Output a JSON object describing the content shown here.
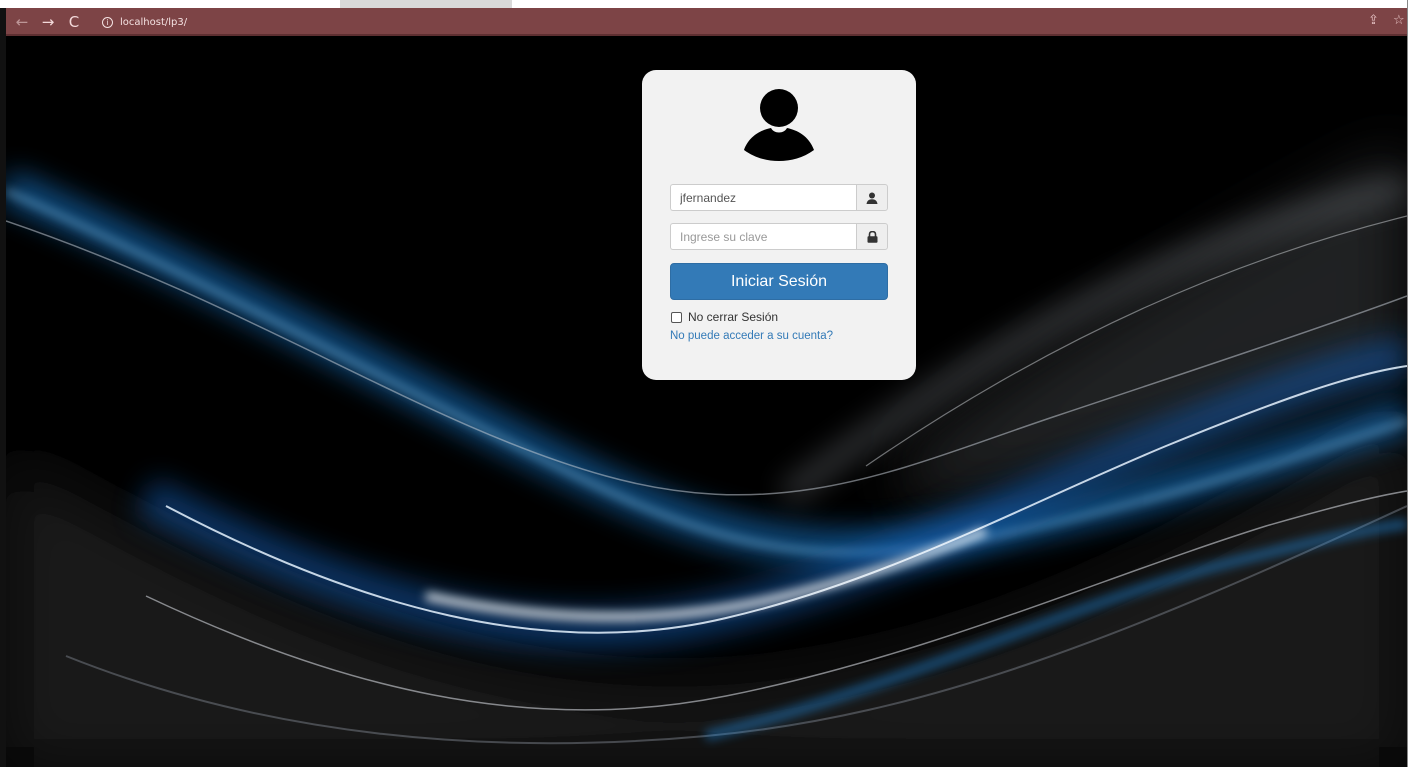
{
  "browser": {
    "url": "localhost/lp3/",
    "back_glyph": "←",
    "forward_glyph": "→",
    "reload_glyph": "C",
    "info_glyph": "i",
    "share_glyph": "⇪",
    "star_glyph": "☆",
    "toolbar_color": "#7d4446"
  },
  "login": {
    "username_value": "jfernandez",
    "password_placeholder": "Ingrese su clave",
    "submit_label": "Iniciar Sesión",
    "remember_label": "No cerrar Sesión",
    "remember_checked": false,
    "forgot_link": "No puede acceder a su cuenta?",
    "button_color": "#337ab7",
    "link_color": "#337ab7"
  },
  "icons": {
    "avatar": "user-avatar-icon",
    "username_addon": "user-icon",
    "password_addon": "lock-icon"
  }
}
